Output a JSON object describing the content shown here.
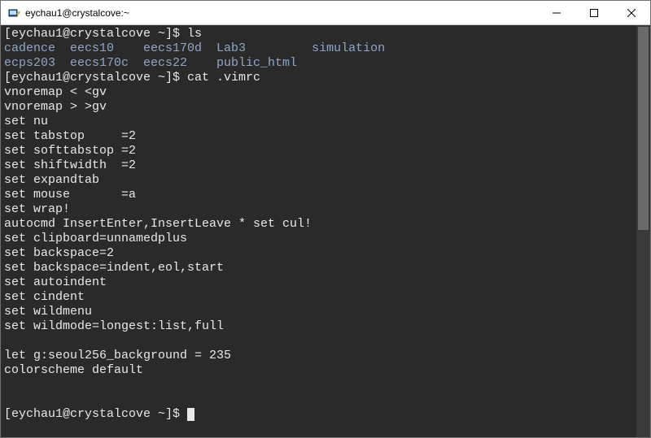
{
  "window": {
    "title": "eychau1@crystalcove:~"
  },
  "prompt": {
    "text": "[eychau1@crystalcove ~]$ "
  },
  "commands": {
    "ls": "ls",
    "cat": "cat .vimrc"
  },
  "ls_output": {
    "row1": [
      "cadence",
      "eecs10",
      "eecs170d",
      "Lab3",
      "simulation"
    ],
    "row2": [
      "ecps203",
      "eecs170c",
      "eecs22",
      "public_html"
    ]
  },
  "vimrc_lines": [
    "vnoremap < <gv",
    "vnoremap > >gv",
    "set nu",
    "set tabstop     =2",
    "set softtabstop =2",
    "set shiftwidth  =2",
    "set expandtab",
    "set mouse       =a",
    "set wrap!",
    "autocmd InsertEnter,InsertLeave * set cul!",
    "set clipboard=unnamedplus",
    "set backspace=2",
    "set backspace=indent,eol,start",
    "set autoindent",
    "set cindent",
    "set wildmenu",
    "set wildmode=longest:list,full",
    "",
    "let g:seoul256_background = 235",
    "colorscheme default",
    "",
    ""
  ],
  "ls_padded": {
    "r1c1": "cadence  ",
    "r1c2": "eecs10    ",
    "r1c3": "eecs170d  ",
    "r1c4": "Lab3         ",
    "r1c5": "simulation",
    "r2c1": "ecps203  ",
    "r2c2": "eecs170c  ",
    "r2c3": "eecs22    ",
    "r2c4": "public_html"
  }
}
